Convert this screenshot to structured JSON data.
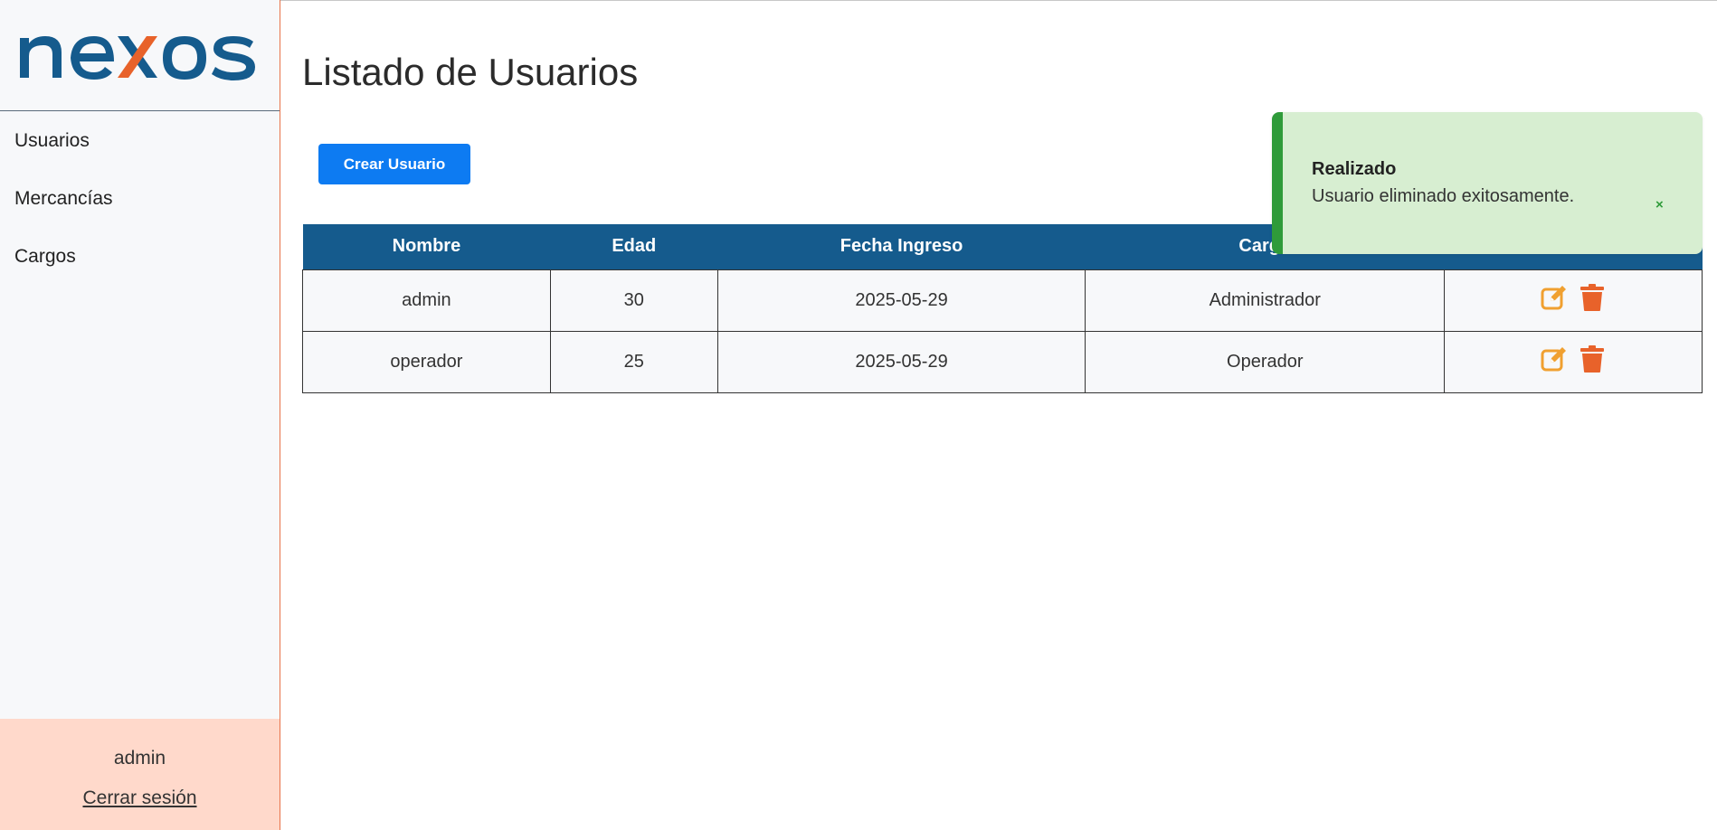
{
  "sidebar": {
    "logo_text": "nexos",
    "items": [
      {
        "label": "Usuarios"
      },
      {
        "label": "Mercancías"
      },
      {
        "label": "Cargos"
      }
    ],
    "user": {
      "name": "admin",
      "logout_label": "Cerrar sesión"
    }
  },
  "main": {
    "title": "Listado de Usuarios",
    "create_button": "Crear Usuario",
    "table": {
      "headers": [
        "Nombre",
        "Edad",
        "Fecha Ingreso",
        "Cargo",
        ""
      ],
      "rows": [
        {
          "nombre": "admin",
          "edad": "30",
          "fecha": "2025-05-29",
          "cargo": "Administrador"
        },
        {
          "nombre": "operador",
          "edad": "25",
          "fecha": "2025-05-29",
          "cargo": "Operador"
        }
      ]
    }
  },
  "toast": {
    "title": "Realizado",
    "message": "Usuario eliminado exitosamente.",
    "close": "×"
  },
  "colors": {
    "brand_blue": "#155b8d",
    "brand_orange": "#e8622a",
    "button_blue": "#0d7bf2",
    "toast_green": "#2f9b3a",
    "edit_icon": "#f0a030",
    "delete_icon": "#e8622a"
  },
  "icons": {
    "edit": "edit-icon",
    "delete": "trash-icon",
    "close": "close-icon"
  }
}
